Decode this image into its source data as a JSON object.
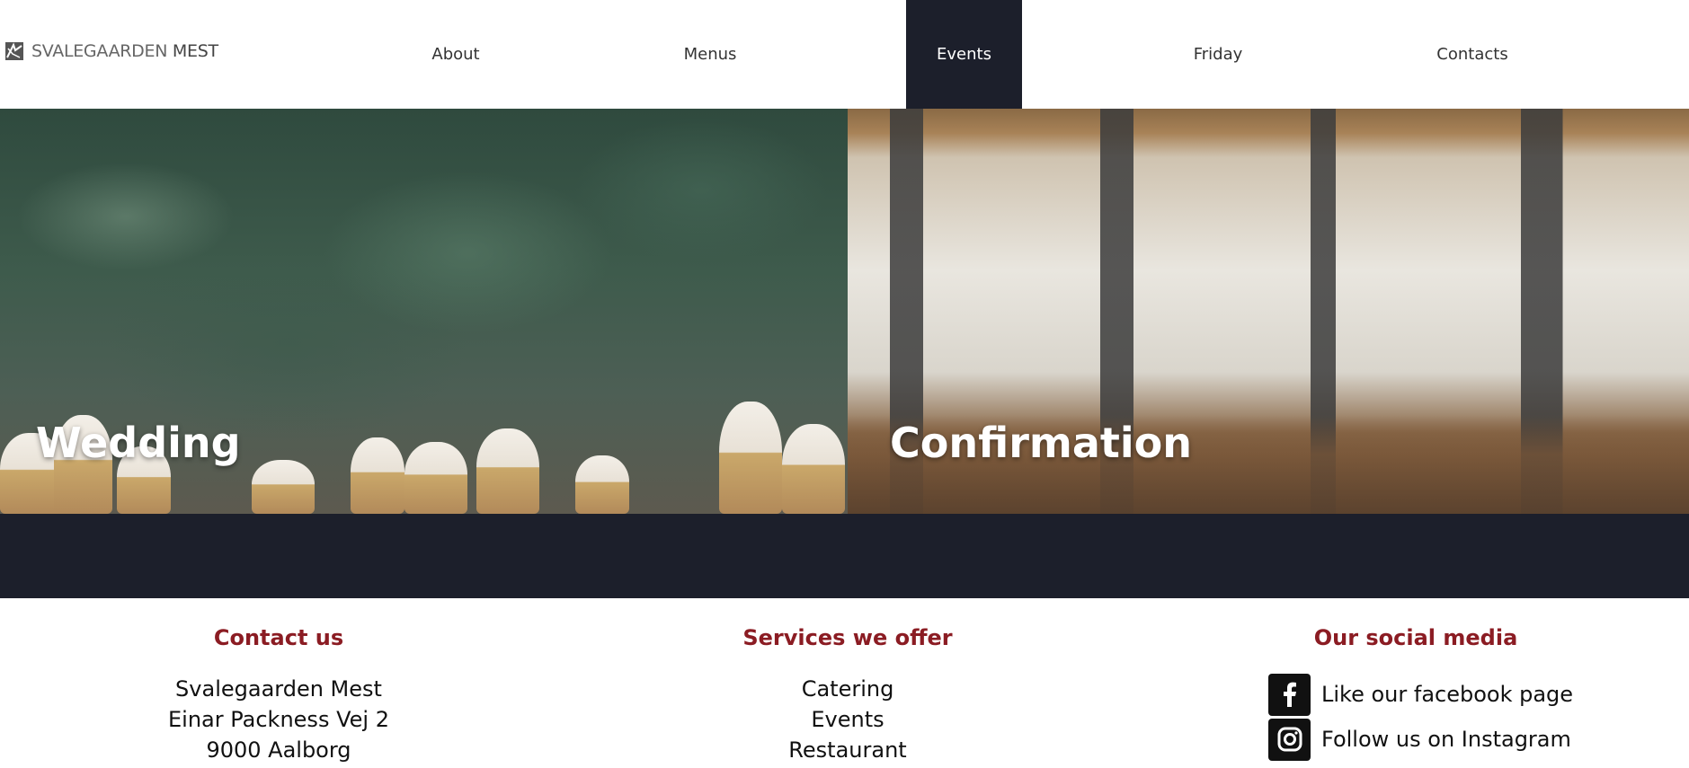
{
  "header": {
    "logo": {
      "text_light": "SVALEGAARDEN",
      "text_strong": "MEST"
    },
    "nav": [
      {
        "label": "About",
        "active": false
      },
      {
        "label": "Menus",
        "active": false
      },
      {
        "label": "Events",
        "active": true
      },
      {
        "label": "Friday",
        "active": false
      },
      {
        "label": "Contacts",
        "active": false
      }
    ]
  },
  "hero": {
    "tiles": [
      {
        "title": "Wedding"
      },
      {
        "title": "Confirmation"
      }
    ]
  },
  "footer": {
    "contact": {
      "heading": "Contact us",
      "lines": [
        "Svalegaarden Mest",
        "Einar Packness Vej 2",
        "9000 Aalborg"
      ]
    },
    "services": {
      "heading": "Services we offer",
      "items": [
        "Catering",
        "Events",
        "Restaurant"
      ]
    },
    "social": {
      "heading": "Our social media",
      "links": [
        {
          "label": "Like our facebook page",
          "icon": "facebook-icon"
        },
        {
          "label": "Follow us on Instagram",
          "icon": "instagram-icon"
        }
      ]
    }
  },
  "colors": {
    "dark": "#1c1f2b",
    "accent_red": "#8b1c23"
  }
}
